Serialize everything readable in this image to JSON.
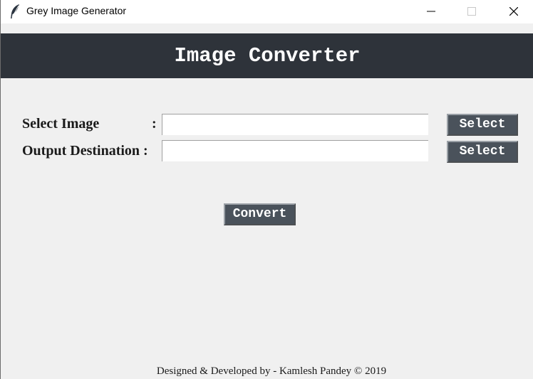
{
  "window": {
    "title": "Grey Image Generator",
    "icon": "feather-icon",
    "controls": [
      "minimize-icon",
      "maximize-icon",
      "close-icon"
    ]
  },
  "header": {
    "title": "Image Converter",
    "background": "#2e333a",
    "text_color": "#ffffff"
  },
  "form": {
    "select_image": {
      "label": "Select Image",
      "colon": ":",
      "value": "",
      "button_label": "Select"
    },
    "output_destination": {
      "label": "Output Destination :",
      "value": "",
      "button_label": "Select"
    },
    "convert_label": "Convert",
    "button_color": "#4a525b"
  },
  "footer": {
    "text": "Designed & Developed by - Kamlesh Pandey © 2019"
  }
}
